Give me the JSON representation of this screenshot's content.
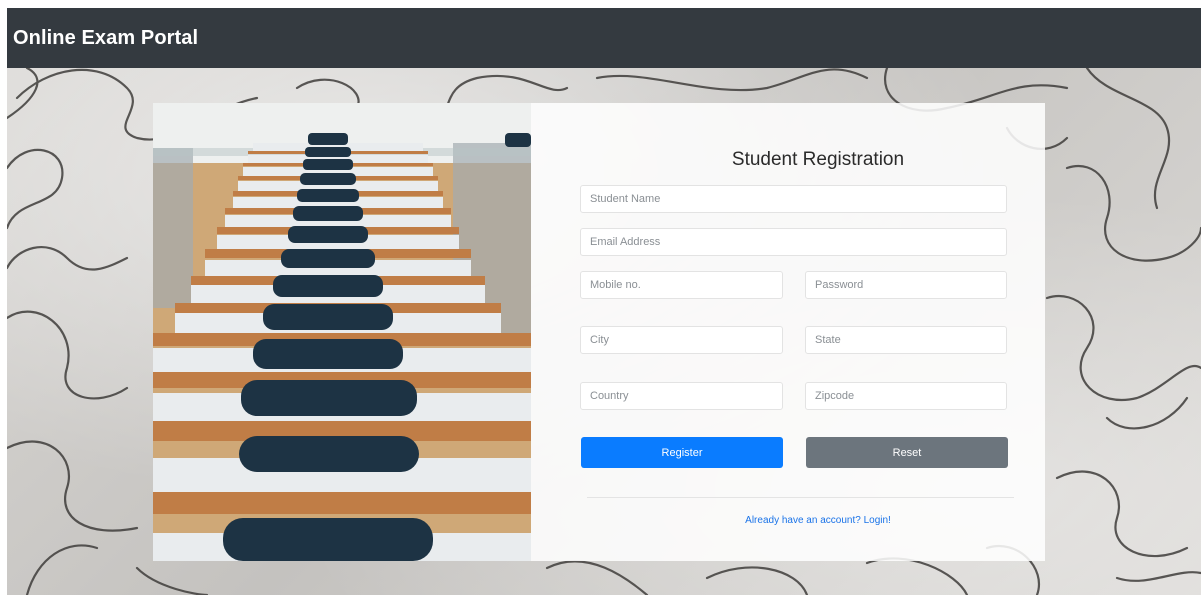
{
  "navbar": {
    "brand": "Online Exam Portal"
  },
  "form": {
    "title": "Student Registration",
    "fields": {
      "student_name": {
        "placeholder": "Student Name",
        "value": ""
      },
      "email": {
        "placeholder": "Email Address",
        "value": ""
      },
      "mobile": {
        "placeholder": "Mobile no.",
        "value": ""
      },
      "password": {
        "placeholder": "Password",
        "value": ""
      },
      "city": {
        "placeholder": "City",
        "value": ""
      },
      "state": {
        "placeholder": "State",
        "value": ""
      },
      "country": {
        "placeholder": "Country",
        "value": ""
      },
      "zipcode": {
        "placeholder": "Zipcode",
        "value": ""
      }
    },
    "register_label": "Register",
    "reset_label": "Reset",
    "login_link": "Already have an account? Login!"
  },
  "colors": {
    "navbar": "#343a40",
    "primary": "#0a7cff",
    "secondary": "#6c757d",
    "link": "#1a73e8"
  },
  "images": {
    "background": "jigsaw-puzzle-background",
    "photo": "exam-hall-desks-chairs-photo"
  }
}
